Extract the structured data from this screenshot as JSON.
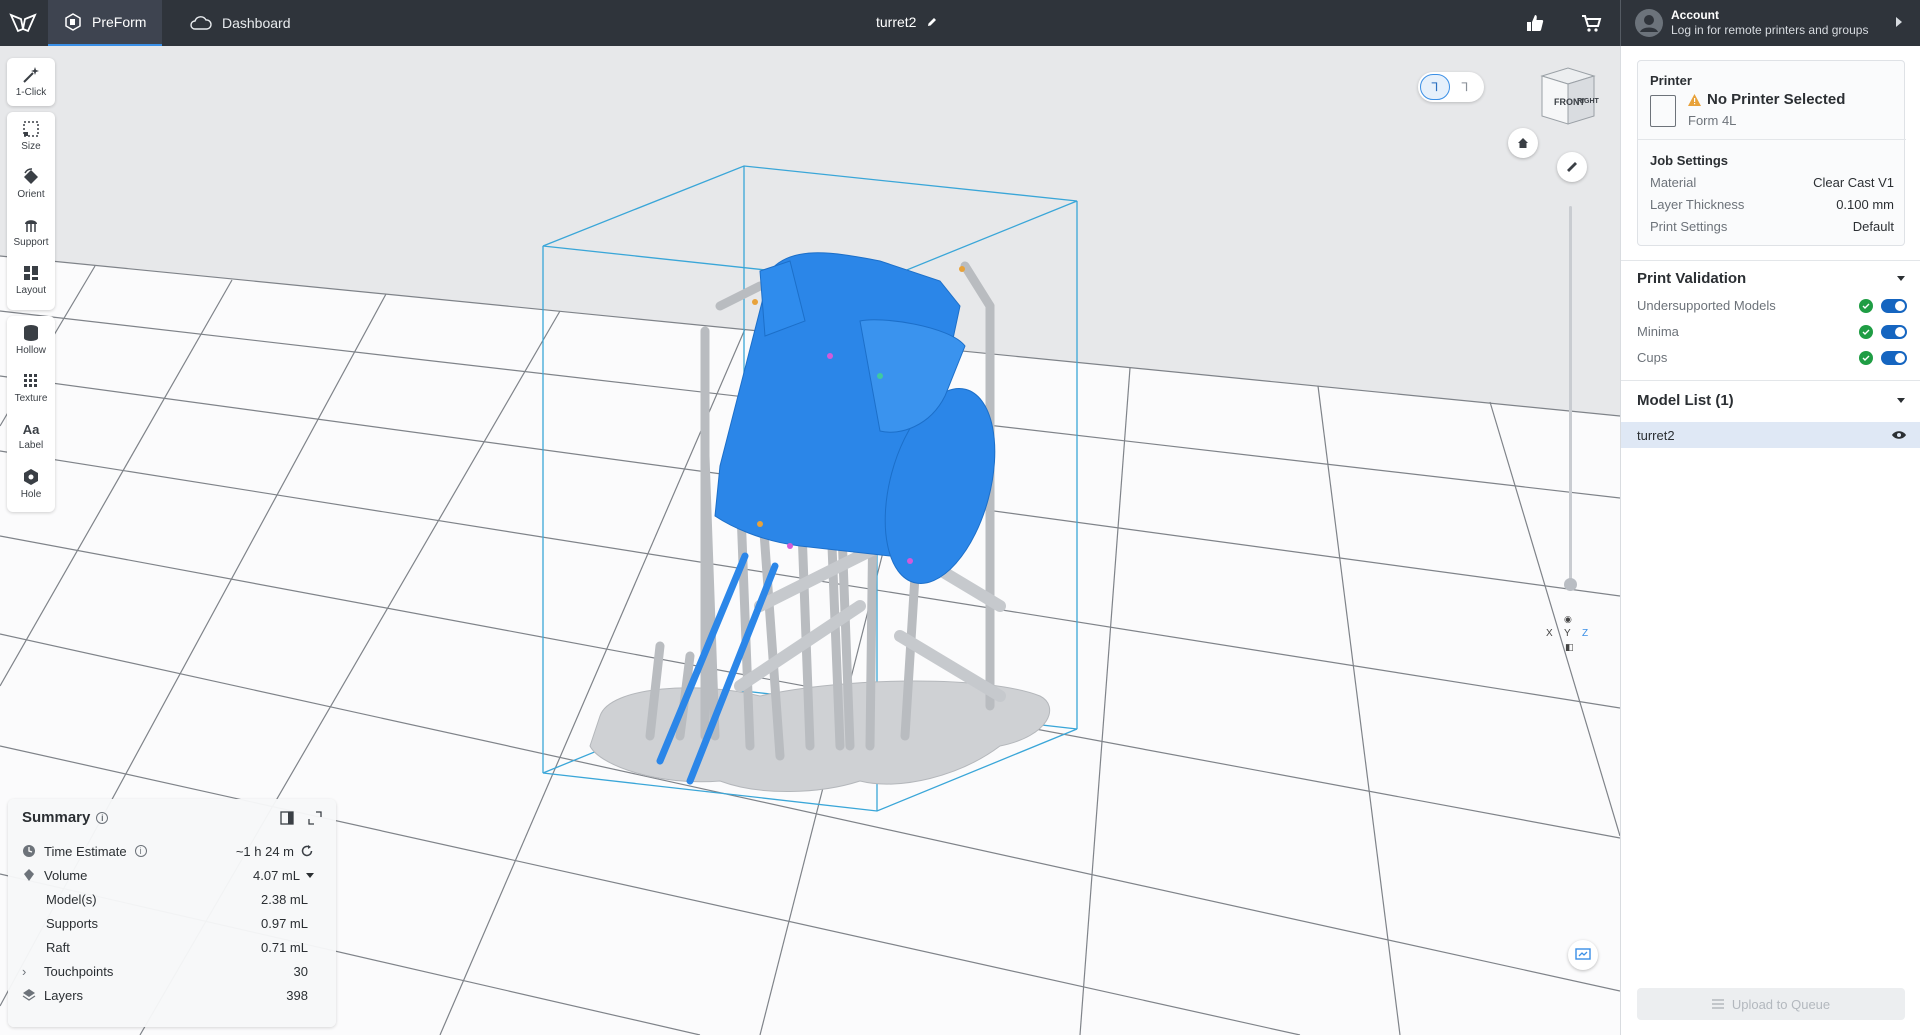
{
  "topbar": {
    "tabs": [
      {
        "label": "PreForm",
        "icon": "preform-icon",
        "active": true
      },
      {
        "label": "Dashboard",
        "icon": "cloud-icon",
        "active": false
      }
    ],
    "file_title": "turret2",
    "account_title": "Account",
    "account_subtitle": "Log in for remote printers and groups"
  },
  "tools": [
    {
      "label": "1-Click",
      "icon": "magic-wand-icon"
    },
    {
      "label": "Size",
      "icon": "resize-icon"
    },
    {
      "label": "Orient",
      "icon": "orient-icon"
    },
    {
      "label": "Support",
      "icon": "support-icon"
    },
    {
      "label": "Layout",
      "icon": "layout-grid-icon"
    },
    {
      "label": "Hollow",
      "icon": "hollow-cylinder-icon"
    },
    {
      "label": "Texture",
      "icon": "texture-icon"
    },
    {
      "label": "Label",
      "icon": "label-aa-icon"
    },
    {
      "label": "Hole",
      "icon": "hole-cube-icon"
    }
  ],
  "viewcube": {
    "front": "FRONT",
    "right": "RIGHT"
  },
  "axes": {
    "x": "X",
    "y": "Y",
    "z": "Z"
  },
  "summary": {
    "title": "Summary",
    "time_label": "Time Estimate",
    "time_value": "~1 h 24 m",
    "volume_label": "Volume",
    "volume_value": "4.07 mL",
    "models_label": "Model(s)",
    "models_value": "2.38 mL",
    "supports_label": "Supports",
    "supports_value": "0.97 mL",
    "raft_label": "Raft",
    "raft_value": "0.71 mL",
    "touchpoints_label": "Touchpoints",
    "touchpoints_value": "30",
    "layers_label": "Layers",
    "layers_value": "398"
  },
  "printer": {
    "section": "Printer",
    "status": "No Printer Selected",
    "model": "Form 4L"
  },
  "job": {
    "section": "Job Settings",
    "material_label": "Material",
    "material_value": "Clear Cast V1",
    "layer_label": "Layer Thickness",
    "layer_value": "0.100 mm",
    "settings_label": "Print Settings",
    "settings_value": "Default"
  },
  "validation": {
    "title": "Print Validation",
    "items": [
      {
        "label": "Undersupported Models",
        "enabled": true
      },
      {
        "label": "Minima",
        "enabled": true
      },
      {
        "label": "Cups",
        "enabled": true
      }
    ]
  },
  "models": {
    "title": "Model List (1)",
    "items": [
      {
        "name": "turret2"
      }
    ]
  },
  "upload_label": "Upload to Queue",
  "colors": {
    "accent": "#3a8fe6",
    "model_blue": "#2b86e8",
    "topbar": "#2f343b",
    "ok_green": "#1f9d44"
  }
}
